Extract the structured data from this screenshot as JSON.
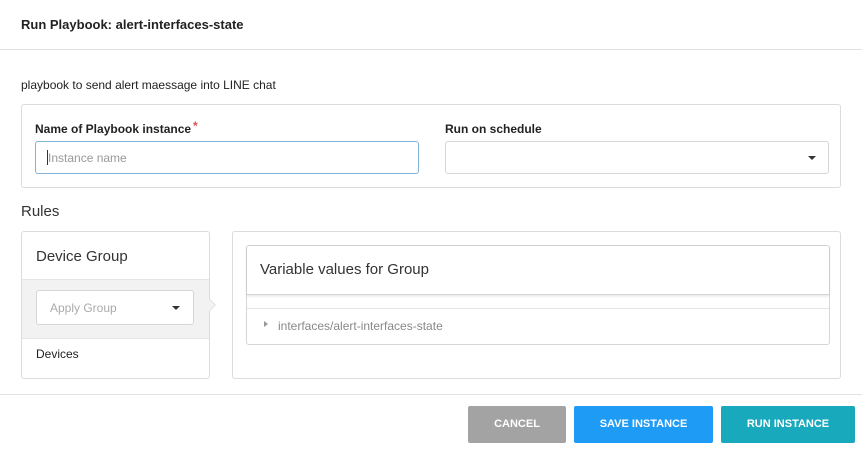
{
  "header": {
    "title": "Run Playbook: alert-interfaces-state"
  },
  "description": "playbook to send alert maessage into LINE chat",
  "form": {
    "name_label": "Name of Playbook instance",
    "required_mark": "*",
    "name_placeholder": "Instance name",
    "name_value": "",
    "schedule_label": "Run on schedule",
    "schedule_value": ""
  },
  "rules": {
    "title": "Rules",
    "device_group": {
      "title": "Device Group",
      "apply_placeholder": "Apply Group",
      "devices_label": "Devices"
    },
    "variables": {
      "title": "Variable values for Group",
      "items": [
        "interfaces/alert-interfaces-state"
      ]
    }
  },
  "footer": {
    "cancel_label": "CANCEL",
    "save_label": "SAVE INSTANCE",
    "run_label": "RUN INSTANCE"
  },
  "colors": {
    "cancel_button": "#a3a3a3",
    "save_button": "#1e9bf5",
    "run_button": "#18a9bd",
    "required_mark": "#d9534f",
    "input_focus_border": "#7fb5d8"
  },
  "icons": {
    "dropdown": "chevron-down-icon",
    "expand": "caret-right-icon",
    "connector": "arrow-right-icon"
  }
}
